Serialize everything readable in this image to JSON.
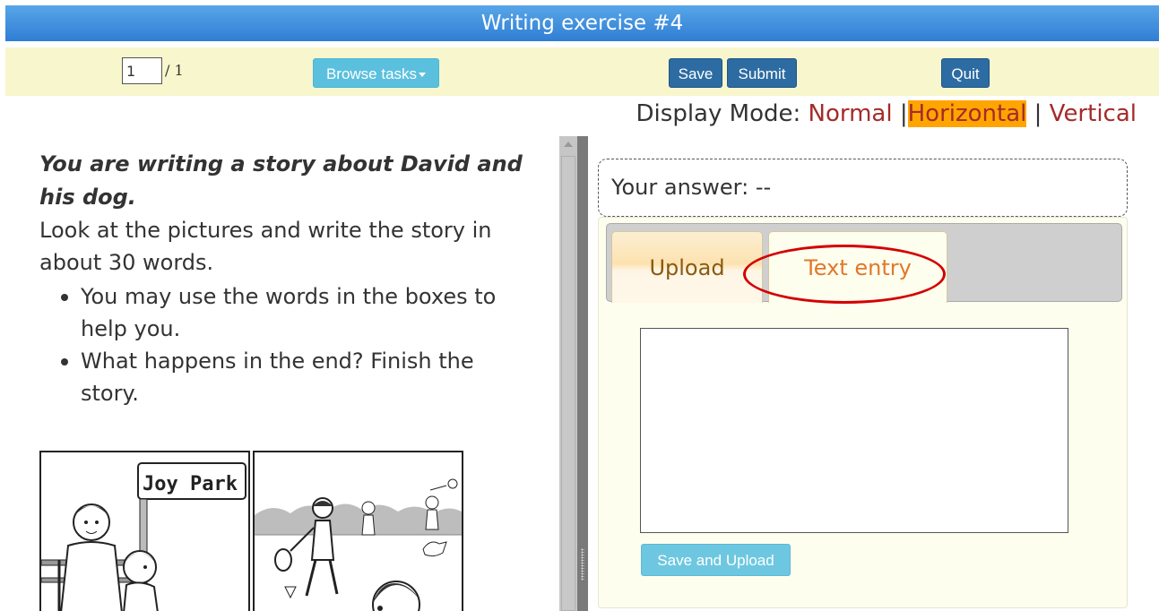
{
  "header": {
    "title": "Writing exercise #4"
  },
  "toolbar": {
    "page_value": "1",
    "page_total": "/ 1",
    "browse_label": "Browse tasks",
    "save_label": "Save",
    "submit_label": "Submit",
    "quit_label": "Quit"
  },
  "display_mode": {
    "label": "Display Mode:",
    "options": [
      "Normal",
      "Horizontal",
      "Vertical"
    ],
    "separator": "|",
    "active": "Horizontal"
  },
  "task": {
    "title_line1": "You are writing a story about David and",
    "title_line2": "his dog.",
    "instruction_line1": "Look at the pictures and write the story in",
    "instruction_line2": "about 30 words.",
    "bullets": [
      {
        "line1": "You may use the words in the boxes to",
        "line2": "help you."
      },
      {
        "line1": "What happens in the end? Finish the",
        "line2": "story."
      }
    ],
    "sign_text": "Joy Park"
  },
  "answer": {
    "label": "Your answer: --",
    "tabs": [
      "Upload",
      "Text entry"
    ],
    "active_tab": "Text entry",
    "textarea_value": "",
    "upload_button": "Save and Upload"
  },
  "colors": {
    "title_bar": "#2f7ed3",
    "toolbar_bg": "#f8f6cc",
    "primary_button": "#2d6ca2",
    "info_button": "#5bc0de",
    "mode_link": "#a52a2a",
    "mode_active_bg": "#ffa500",
    "highlight_oval": "#d40000",
    "answer_panel_bg": "#fefeef"
  },
  "icons": [
    "caret-down-icon",
    "scroll-up-icon",
    "splitter-grip-icon",
    "textarea-resize-icon"
  ]
}
